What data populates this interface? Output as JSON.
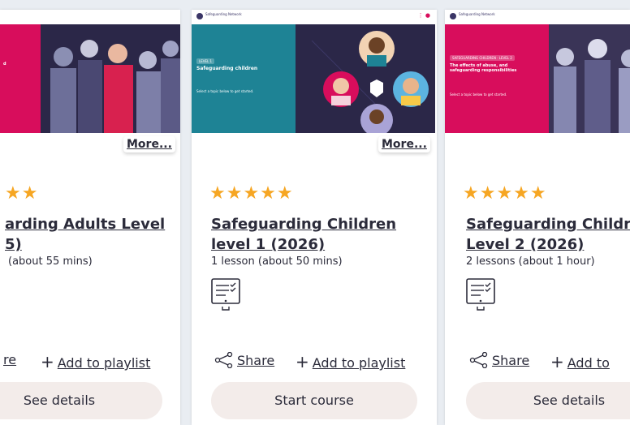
{
  "cards": [
    {
      "more_label": "More...",
      "stars": "★★",
      "title_line1": "arding Adults Level",
      "title_line2": "5)",
      "lessons": "(about 55 mins)",
      "share_label": "re",
      "playlist_label": "Add to playlist",
      "button_label": "See details",
      "hero_heading": "d",
      "hero_accent": "#d80d5c",
      "rating": 5
    },
    {
      "org_name": "Safeguarding Network",
      "more_label": "More...",
      "stars": "★★★★★",
      "title_line1": "Safeguarding Children",
      "title_line2": "level 1 (2026)",
      "lessons": "1 lesson (about 50 mins)",
      "share_label": "Share",
      "playlist_label": "Add to playlist",
      "button_label": "Start course",
      "hero_tag": "LEVEL 1",
      "hero_heading": "Safeguarding children",
      "hero_body": "Select a topic below to get started.",
      "hero_accent": "#1e8395",
      "rating": 5
    },
    {
      "org_name": "Safeguarding Network",
      "stars": "★★★★★",
      "title_line1": "Safeguarding Childre",
      "title_line2": "Level 2 (2026)",
      "lessons": "2 lessons (about 1 hour)",
      "share_label": "Share",
      "playlist_label": "Add to",
      "button_label": "See details",
      "hero_tag": "SAFEGUARDING CHILDREN · LEVEL 2",
      "hero_heading": "The effects of abuse, and safeguarding responsibilities",
      "hero_body": "Select a topic below to get started.",
      "hero_accent": "#d80d5c",
      "rating": 5
    }
  ],
  "colors": {
    "star": "#f6a623",
    "button_bg": "#f3ecea",
    "hero_dark": "#2b2748"
  }
}
